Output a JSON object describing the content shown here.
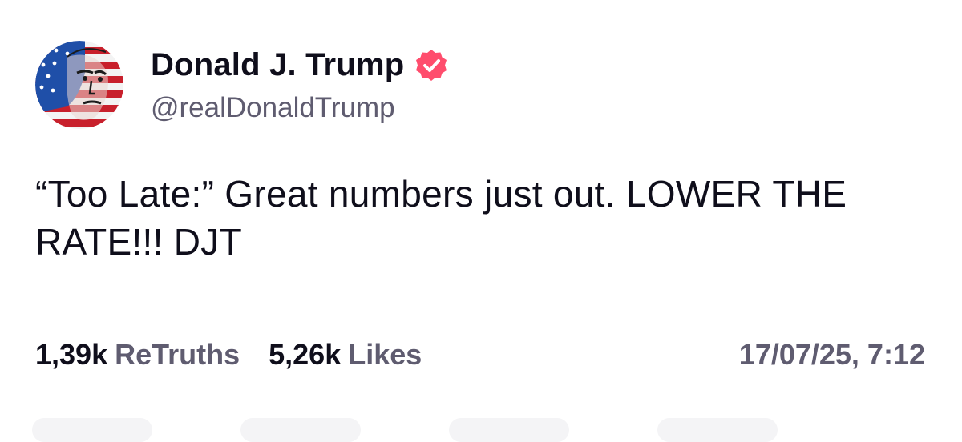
{
  "post": {
    "author": {
      "display_name": "Donald J. Trump",
      "handle": "@realDonaldTrump",
      "verified": true,
      "avatar_icon": "flag-portrait-avatar"
    },
    "text": "“Too Late:” Great numbers just out. LOWER THE RATE!!! DJT",
    "stats": {
      "retruths_count": "1,39k",
      "retruths_label": "ReTruths",
      "likes_count": "5,26k",
      "likes_label": "Likes"
    },
    "timestamp": "17/07/25, 7:12"
  },
  "colors": {
    "text_primary": "#0f0e1b",
    "text_secondary": "#5f5c70",
    "verified_badge": "#ff4d6d"
  }
}
